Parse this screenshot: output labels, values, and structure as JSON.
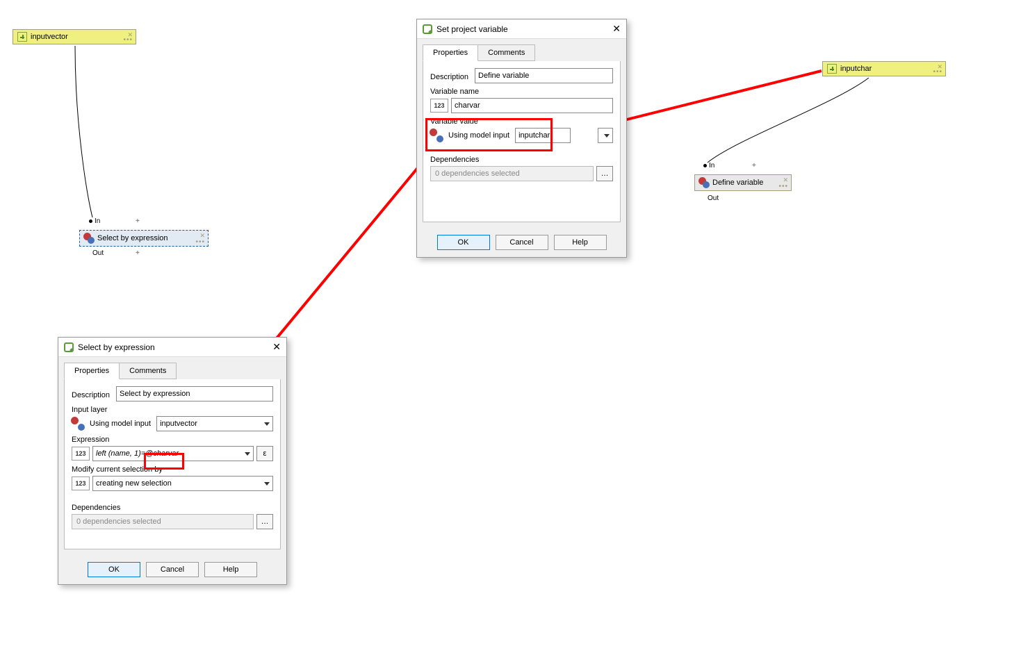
{
  "nodes": {
    "inputvector": {
      "label": "inputvector"
    },
    "inputchar": {
      "label": "inputchar"
    },
    "selectexpr": {
      "label": "Select by expression",
      "in": "In",
      "out": "Out"
    },
    "definevar": {
      "label": "Define variable",
      "in": "In",
      "out": "Out"
    }
  },
  "dialog1": {
    "title": "Set project variable",
    "tabs": {
      "properties": "Properties",
      "comments": "Comments"
    },
    "desc_lbl": "Description",
    "desc_val": "Define variable",
    "varname_lbl": "Variable name",
    "varname_val": "charvar",
    "varval_lbl": "Variable value",
    "varval_mode": "Using model input",
    "varval_input": "inputchar",
    "deps_lbl": "Dependencies",
    "deps_val": "0 dependencies selected",
    "ok": "OK",
    "cancel": "Cancel",
    "help": "Help"
  },
  "dialog2": {
    "title": "Select by expression",
    "tabs": {
      "properties": "Properties",
      "comments": "Comments"
    },
    "desc_lbl": "Description",
    "desc_val": "Select by expression",
    "inputlayer_lbl": "Input layer",
    "inputlayer_mode": "Using model input",
    "inputlayer_val": "inputvector",
    "expr_lbl": "Expression",
    "expr_prefix": "left (name, 1)=",
    "expr_hilite": "@charvar",
    "modify_lbl": "Modify current selection by",
    "modify_val": "creating new selection",
    "deps_lbl": "Dependencies",
    "deps_val": "0 dependencies selected",
    "ok": "OK",
    "cancel": "Cancel",
    "help": "Help",
    "epsilon": "ε"
  },
  "num_icon": "123"
}
